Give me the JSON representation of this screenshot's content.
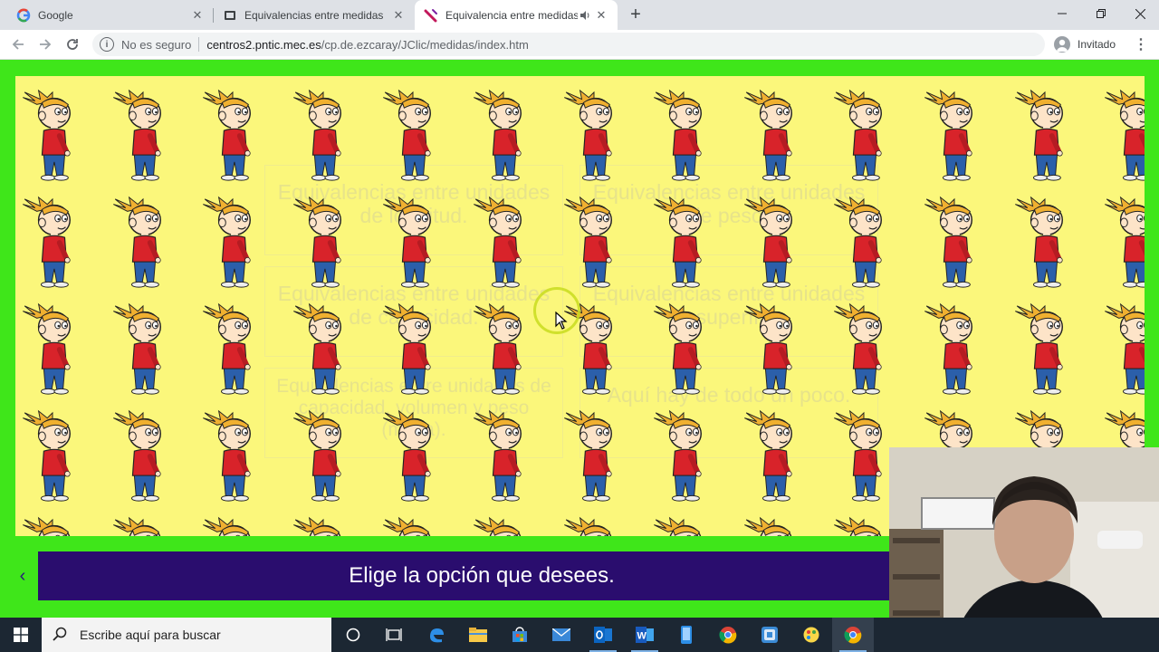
{
  "browser": {
    "tabs": [
      {
        "title": "Google",
        "favicon": "google-icon",
        "active": false
      },
      {
        "title": "Equivalencias entre medidas",
        "favicon": "page-icon",
        "active": false
      },
      {
        "title": "Equivalencia entre medidas c",
        "favicon": "jclic-icon",
        "active": true,
        "audio": "speaker-icon"
      }
    ],
    "new_tab": "+",
    "address": {
      "security_label": "No es seguro",
      "url_host": "centros2.pntic.mec.es",
      "url_path": "/cp.de.ezcaray/JClic/medidas/index.htm"
    },
    "profile_label": "Invitado"
  },
  "activity": {
    "background_options": [
      "Equivalencias entre unidades de longitud.",
      "Equivalencias entre unidades de peso.",
      "Equivalencias entre unidades de capacidad.",
      "Equivalencias entre unidades de superficie.",
      "Equivalencias entre unidades de capacidad, volumen y peso (masa).",
      "Aquí hay de todo un poco."
    ],
    "message": "Elige la opción que desees.",
    "colors": {
      "frame": "#3fe61a",
      "stage": "#fbf77b",
      "message_bar": "#2a0d6e"
    }
  },
  "taskbar": {
    "search_placeholder": "Escribe aquí para buscar",
    "pinned": [
      "cortana-icon",
      "task-view-icon",
      "edge-icon",
      "file-explorer-icon",
      "store-icon",
      "mail-icon",
      "outlook-icon",
      "word-icon",
      "phone-icon",
      "chrome-icon",
      "app-icon",
      "paint-icon",
      "chrome-active-icon"
    ]
  }
}
